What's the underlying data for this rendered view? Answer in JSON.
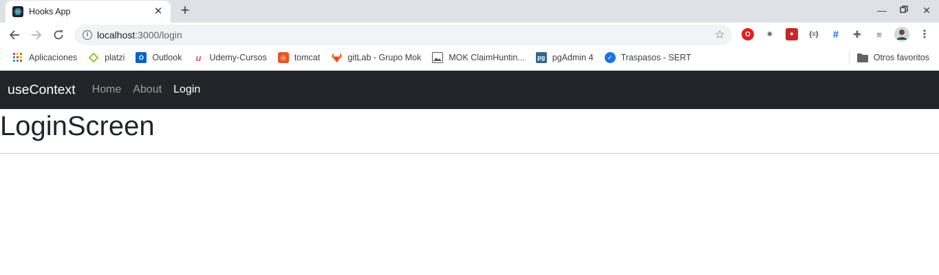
{
  "browser": {
    "tab": {
      "title": "Hooks App",
      "favicon": "react-icon"
    },
    "url": {
      "host": "localhost",
      "path": ":3000/login"
    },
    "bookmarks": [
      {
        "label": "Aplicaciones",
        "icon": "apps-grid-icon"
      },
      {
        "label": "platzi",
        "icon": "platzi-icon",
        "color": "#98ca3f"
      },
      {
        "label": "Outlook",
        "icon": "outlook-icon",
        "color": "#0a64c8"
      },
      {
        "label": "Udemy-Cursos",
        "icon": "udemy-icon",
        "color": "#ec5252"
      },
      {
        "label": "tomcat",
        "icon": "ubuntu-icon",
        "color": "#e95420"
      },
      {
        "label": "gitLab - Grupo Mok",
        "icon": "gitlab-icon",
        "color": "#fc6d26"
      },
      {
        "label": "MOK ClaimHuntin...",
        "icon": "image-icon",
        "color": "#555555"
      },
      {
        "label": "pgAdmin 4",
        "icon": "pgadmin-icon",
        "color": "#336791"
      },
      {
        "label": "Traspasos - SERT",
        "icon": "check-badge-icon",
        "color": "#1a73e8"
      }
    ],
    "other_bookmarks": "Otros favoritos"
  },
  "app": {
    "brand": "useContext",
    "nav": {
      "home": "Home",
      "about": "About",
      "login": "Login"
    },
    "page_title": "LoginScreen"
  },
  "colors": {
    "navbar_bg": "#212529",
    "tabstrip_bg": "#dee1e6",
    "omnibox_bg": "#f1f3f4"
  }
}
